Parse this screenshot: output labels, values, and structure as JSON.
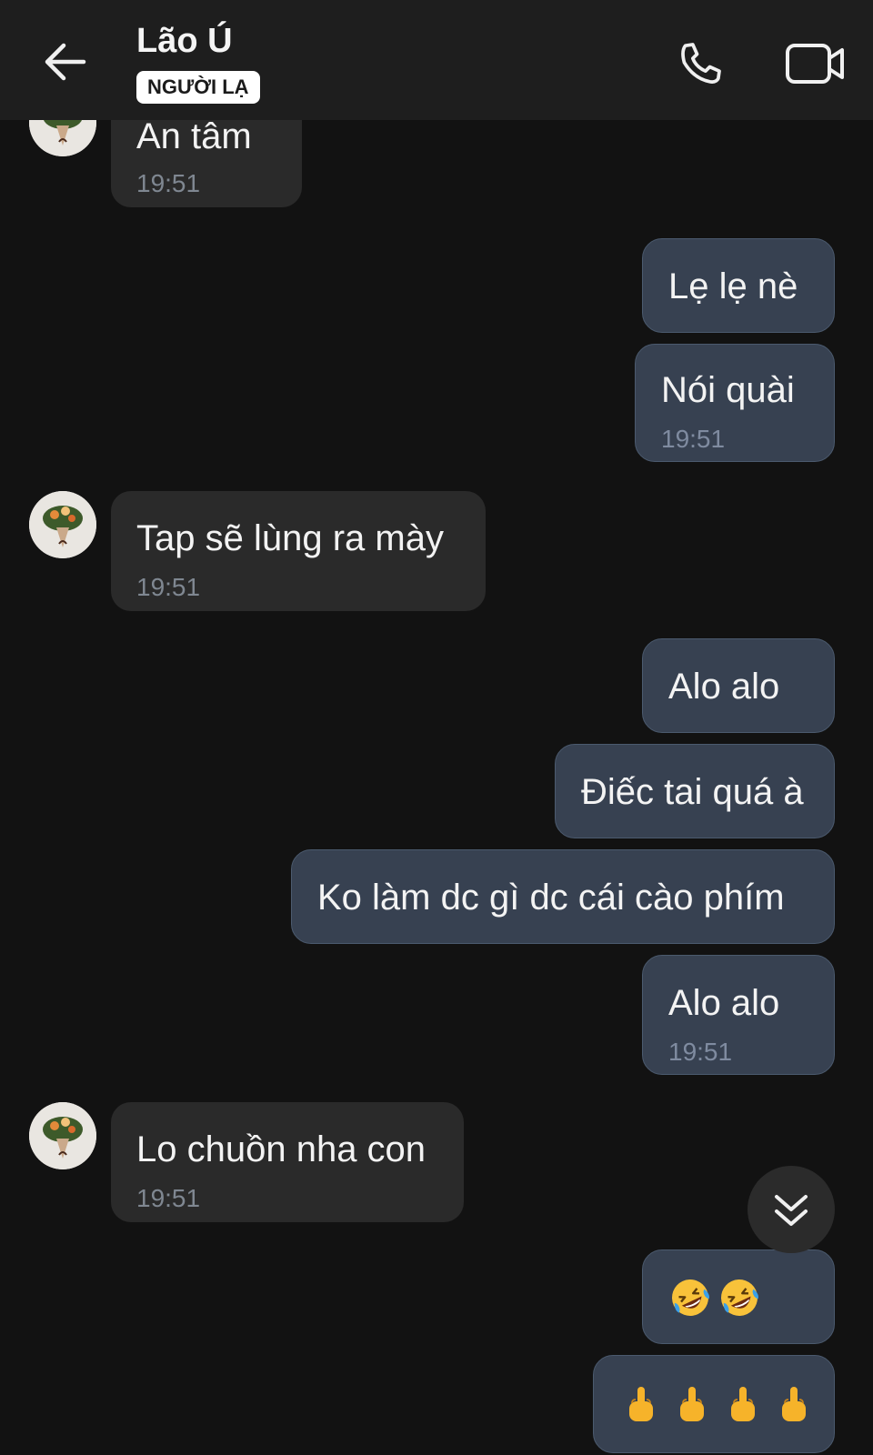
{
  "header": {
    "contact_name": "Lão Ú",
    "badge": "NGƯỜI LẠ"
  },
  "colors": {
    "background": "#121212",
    "incoming_bubble": "#2a2a2a",
    "outgoing_bubble": "#374151",
    "timestamp": "#7f8791"
  },
  "icons": [
    "back-arrow-icon",
    "phone-icon",
    "video-camera-icon",
    "double-chevron-down-icon"
  ],
  "messages": [
    {
      "dir": "in",
      "text": "An tâm",
      "time": "19:51"
    },
    {
      "dir": "out",
      "text": "Lẹ lẹ nè"
    },
    {
      "dir": "out",
      "text": "Nói quài",
      "time": "19:51"
    },
    {
      "dir": "in",
      "text": "Tap sẽ lùng ra mày",
      "time": "19:51"
    },
    {
      "dir": "out",
      "text": "Alo alo"
    },
    {
      "dir": "out",
      "text": "Điếc tai quá à"
    },
    {
      "dir": "out",
      "text": "Ko làm dc gì dc cái cào phím"
    },
    {
      "dir": "out",
      "text": "Alo alo",
      "time": "19:51"
    },
    {
      "dir": "in",
      "text": "Lo chuồn nha con",
      "time": "19:51"
    },
    {
      "dir": "out",
      "emoji": "rolling-on-floor-laughing",
      "count": 2
    },
    {
      "dir": "out",
      "emoji": "middle-finger",
      "count": 4
    }
  ]
}
